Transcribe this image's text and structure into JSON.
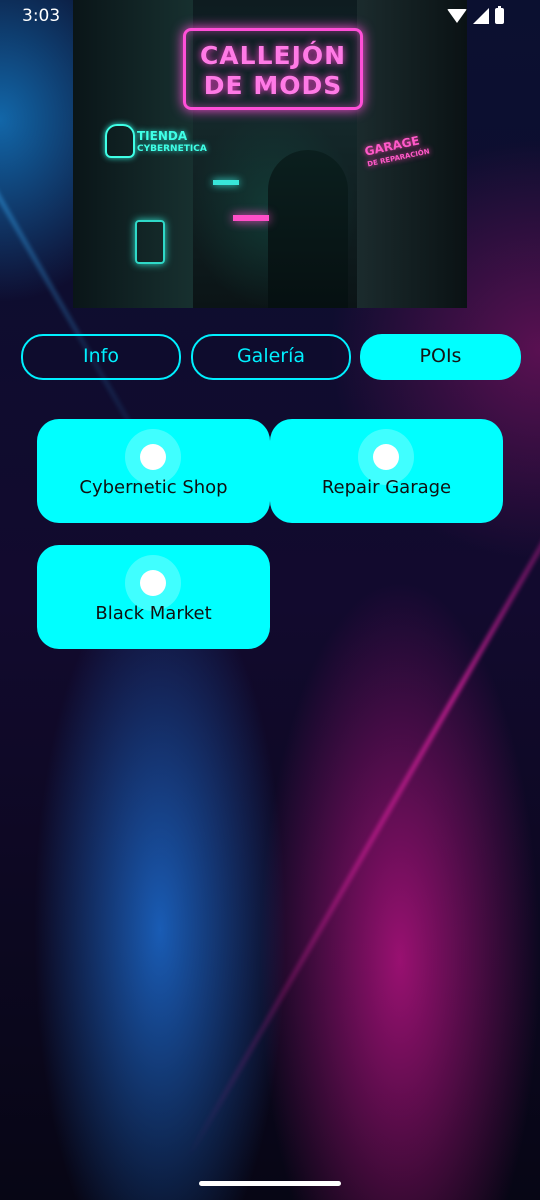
{
  "status_bar": {
    "time": "3:03"
  },
  "hero": {
    "sign_main_line1": "CALLEJÓN",
    "sign_main_line2": "DE MODS",
    "sign_shop_line1": "TIENDA",
    "sign_shop_line2": "CYBERNETICA",
    "sign_garage_line1": "GARAGE",
    "sign_garage_line2": "DE REPARACIÓN"
  },
  "tabs": [
    {
      "label": "Info",
      "selected": false
    },
    {
      "label": "Galería",
      "selected": false
    },
    {
      "label": "POIs",
      "selected": true
    }
  ],
  "pois": [
    {
      "label": "Cybernetic Shop",
      "icon": "circle-marker-icon"
    },
    {
      "label": "Repair Garage",
      "icon": "circle-marker-icon"
    },
    {
      "label": "Black Market",
      "icon": "circle-marker-icon"
    }
  ],
  "colors": {
    "accent": "#00FFFF",
    "tab_text_selected": "#141414",
    "neon_pink": "#FF4FD8",
    "neon_cyan": "#3FFFE6"
  }
}
